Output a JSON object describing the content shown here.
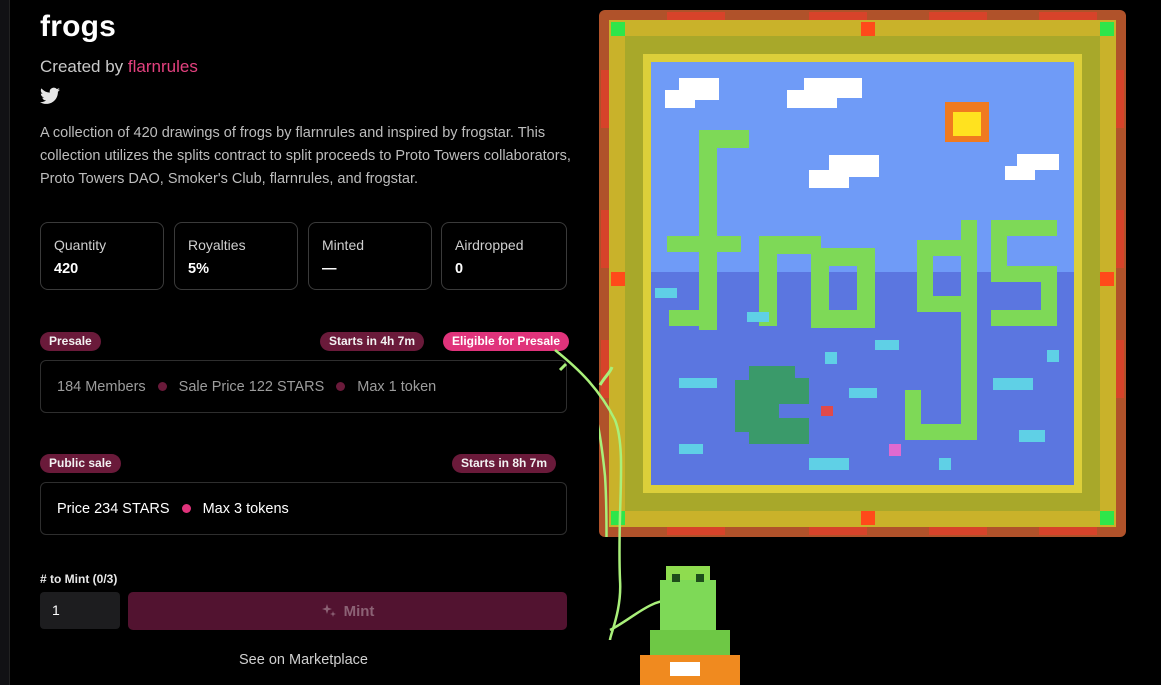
{
  "collection": {
    "title": "frogs",
    "created_by_prefix": "Created by",
    "creator": "flarnrules",
    "description": "A collection of 420 drawings of frogs by flarnrules and inspired by frogstar. This collection utilizes the splits contract to split proceeds to Proto Towers collaborators, Proto Towers DAO, Smoker's Club, flarnrules, and frogstar."
  },
  "stats": [
    {
      "label": "Quantity",
      "value": "420"
    },
    {
      "label": "Royalties",
      "value": "5%"
    },
    {
      "label": "Minted",
      "value": "—"
    },
    {
      "label": "Airdropped",
      "value": "0"
    }
  ],
  "presale": {
    "badge": "Presale",
    "starts": "Starts in 4h 7m",
    "eligible": "Eligible for Presale",
    "members": "184 Members",
    "price": "Sale Price 122 STARS",
    "max": "Max 1 token"
  },
  "public_sale": {
    "badge": "Public sale",
    "starts": "Starts in 8h 7m",
    "price": "Price 234 STARS",
    "max": "Max 3 tokens"
  },
  "mint": {
    "label": "# to Mint (0/3)",
    "quantity_value": "1",
    "button_label": "Mint",
    "marketplace_link": "See on Marketplace"
  },
  "icons": {
    "social": "twitter-icon",
    "mint": "sparkles-icon",
    "artwork": "frogs-pixel-art"
  },
  "colors": {
    "accent": "#e0337b",
    "badge": "#6a1a3a",
    "mint_button": "#521330",
    "background": "#000000"
  }
}
